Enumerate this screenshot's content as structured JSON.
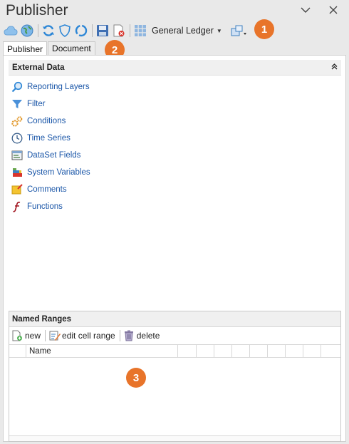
{
  "window": {
    "title": "Publisher",
    "minimize_glyph": "∨",
    "close_glyph": "✕"
  },
  "toolbar": {
    "icons": [
      "cloud-icon",
      "globe-icon",
      "refresh-icon",
      "shield-icon",
      "sync-icon",
      "save-icon",
      "delete-file-icon",
      "grid-icon"
    ],
    "ledger_label": "General Ledger",
    "layout_icon": "add-window-icon"
  },
  "badges": {
    "one": "1",
    "two": "2",
    "three": "3"
  },
  "tabs": {
    "publisher": "Publisher",
    "document": "Document"
  },
  "external_data": {
    "title": "External Data",
    "items": [
      {
        "label": "Reporting Layers",
        "icon": "magnifier-icon"
      },
      {
        "label": "Filter",
        "icon": "funnel-icon"
      },
      {
        "label": "Conditions",
        "icon": "gears-icon"
      },
      {
        "label": "Time Series",
        "icon": "clock-icon"
      },
      {
        "label": "DataSet Fields",
        "icon": "dataset-icon"
      },
      {
        "label": "System Variables",
        "icon": "variables-icon"
      },
      {
        "label": "Comments",
        "icon": "note-icon"
      },
      {
        "label": "Functions",
        "icon": "function-icon"
      }
    ]
  },
  "named_ranges": {
    "title": "Named Ranges",
    "new_label": "new",
    "edit_label": "edit cell range",
    "delete_label": "delete",
    "column_name": "Name"
  },
  "colors": {
    "accent_badge": "#e8742a",
    "link_blue": "#1a56a8"
  }
}
